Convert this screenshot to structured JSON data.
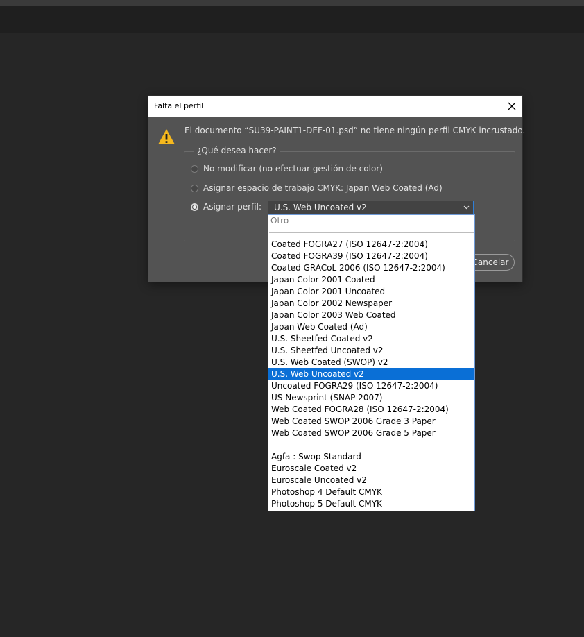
{
  "dialog": {
    "title": "Falta el perfil",
    "message": "El documento “SU39-PAINT1-DEF-01.psd” no tiene ningún perfil CMYK incrustado.",
    "group_label": "¿Qué desea hacer?",
    "options": [
      {
        "label": "No modificar (no efectuar gestión de color)",
        "selected": false
      },
      {
        "label": "Asignar espacio de trabajo CMYK: Japan Web Coated (Ad)",
        "selected": false
      },
      {
        "label": "Asignar perfil:",
        "selected": true
      }
    ],
    "profile_select_value": "U.S. Web Uncoated v2",
    "cancel_label": "Cancelar",
    "cancel_visible_text": "ancelar"
  },
  "dropdown": {
    "other_label": "Otro",
    "group1": [
      "Coated FOGRA27 (ISO 12647-2:2004)",
      "Coated FOGRA39 (ISO 12647-2:2004)",
      "Coated GRACoL 2006 (ISO 12647-2:2004)",
      "Japan Color 2001 Coated",
      "Japan Color 2001 Uncoated",
      "Japan Color 2002 Newspaper",
      "Japan Color 2003 Web Coated",
      "Japan Web Coated (Ad)",
      "U.S. Sheetfed Coated v2",
      "U.S. Sheetfed Uncoated v2",
      "U.S. Web Coated (SWOP) v2",
      "U.S. Web Uncoated v2",
      "Uncoated FOGRA29 (ISO 12647-2:2004)",
      "US Newsprint (SNAP 2007)",
      "Web Coated FOGRA28 (ISO 12647-2:2004)",
      "Web Coated SWOP 2006 Grade 3 Paper",
      "Web Coated SWOP 2006 Grade 5 Paper"
    ],
    "group2": [
      "Agfa : Swop Standard",
      "Euroscale Coated v2",
      "Euroscale Uncoated v2",
      "Photoshop 4 Default CMYK",
      "Photoshop 5 Default CMYK"
    ],
    "selected": "U.S. Web Uncoated v2"
  },
  "colors": {
    "background": "#262626",
    "dialog": "#535353",
    "accent": "#0a6fd6",
    "warning": "#f5b81e"
  }
}
